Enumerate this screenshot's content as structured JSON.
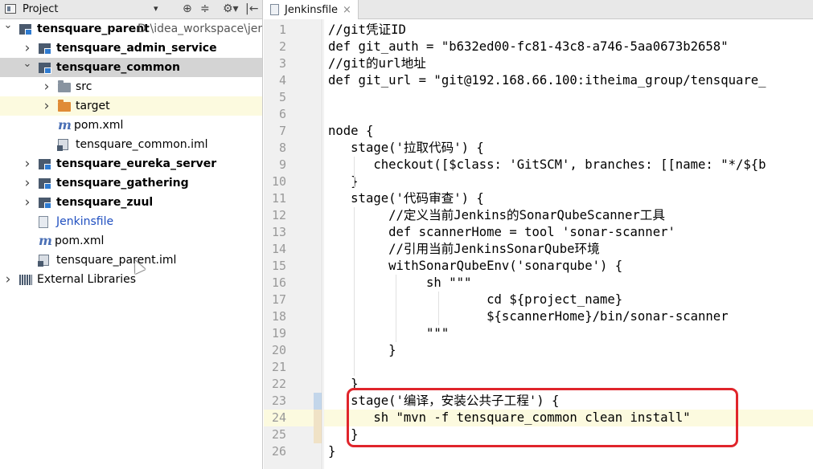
{
  "project_pane": {
    "title": "Project",
    "dropdown_glyph": "▾",
    "toolbar_glyphs": [
      "⊕",
      "≑",
      "⚙▾",
      "|←"
    ],
    "tree": [
      {
        "label": "tensquare_parent",
        "path": "D:\\idea_workspace\\jenk",
        "icon": "module-icon",
        "arrow": "⌄",
        "bold": true,
        "indent": 0
      },
      {
        "label": "tensquare_admin_service",
        "icon": "module-icon",
        "arrow": "›",
        "bold": true,
        "indent": 1
      },
      {
        "label": "tensquare_common",
        "icon": "module-icon",
        "arrow": "⌄",
        "bold": true,
        "indent": 1,
        "selected": true
      },
      {
        "label": "src",
        "icon": "folder-icon",
        "arrow": "›",
        "bold": false,
        "indent": 2
      },
      {
        "label": "target",
        "icon": "folder-orange-icon",
        "arrow": "›",
        "bold": false,
        "indent": 2,
        "highlight": true
      },
      {
        "label": "pom.xml",
        "icon": "maven-icon",
        "arrow": "",
        "bold": false,
        "indent": 2
      },
      {
        "label": "tensquare_common.iml",
        "icon": "iml-icon",
        "arrow": "",
        "bold": false,
        "indent": 2
      },
      {
        "label": "tensquare_eureka_server",
        "icon": "module-icon",
        "arrow": "›",
        "bold": true,
        "indent": 1
      },
      {
        "label": "tensquare_gathering",
        "icon": "module-icon",
        "arrow": "›",
        "bold": true,
        "indent": 1
      },
      {
        "label": "tensquare_zuul",
        "icon": "module-icon",
        "arrow": "›",
        "bold": true,
        "indent": 1
      },
      {
        "label": "Jenkinsfile",
        "icon": "file-icon",
        "arrow": "",
        "bold": false,
        "indent": 1,
        "blue": true
      },
      {
        "label": "pom.xml",
        "icon": "maven-icon",
        "arrow": "",
        "bold": false,
        "indent": 1
      },
      {
        "label": "tensquare_parent.iml",
        "icon": "iml-icon",
        "arrow": "",
        "bold": false,
        "indent": 1
      },
      {
        "label": "External Libraries",
        "icon": "library-icon",
        "arrow": "›",
        "bold": false,
        "indent": 0
      }
    ]
  },
  "editor": {
    "tab": {
      "label": "Jenkinsfile",
      "close": "×"
    },
    "lines": [
      "//git凭证ID",
      "def git_auth = \"b632ed00-fc81-43c8-a746-5aa0673b2658\"",
      "//git的url地址",
      "def git_url = \"git@192.168.66.100:itheima_group/tensquare_",
      "",
      "",
      "node {",
      "   stage('拉取代码') {",
      "      checkout([$class: 'GitSCM', branches: [[name: \"*/${b",
      "   }",
      "   stage('代码审查') {",
      "        //定义当前Jenkins的SonarQubeScanner工具",
      "        def scannerHome = tool 'sonar-scanner'",
      "        //引用当前JenkinsSonarQube环境",
      "        withSonarQubeEnv('sonarqube') {",
      "             sh \"\"\"",
      "                     cd ${project_name}",
      "                     ${scannerHome}/bin/sonar-scanner",
      "             \"\"\"",
      "        }",
      "",
      "   }",
      "   stage('编译，安装公共子工程') {",
      "      sh \"mvn -f tensquare_common clean install\"",
      "   }",
      "}"
    ],
    "line_numbers": [
      "1",
      "2",
      "3",
      "4",
      "5",
      "6",
      "7",
      "8",
      "9",
      "10",
      "11",
      "12",
      "13",
      "14",
      "15",
      "16",
      "17",
      "18",
      "19",
      "20",
      "21",
      "22",
      "23",
      "24",
      "25",
      "26"
    ]
  },
  "colors": {
    "highlight_box": "#e0252b",
    "caret_line": "#fcfadf",
    "selection": "#d4d4d4",
    "jenkinsfile_label": "#1f4fc0"
  }
}
